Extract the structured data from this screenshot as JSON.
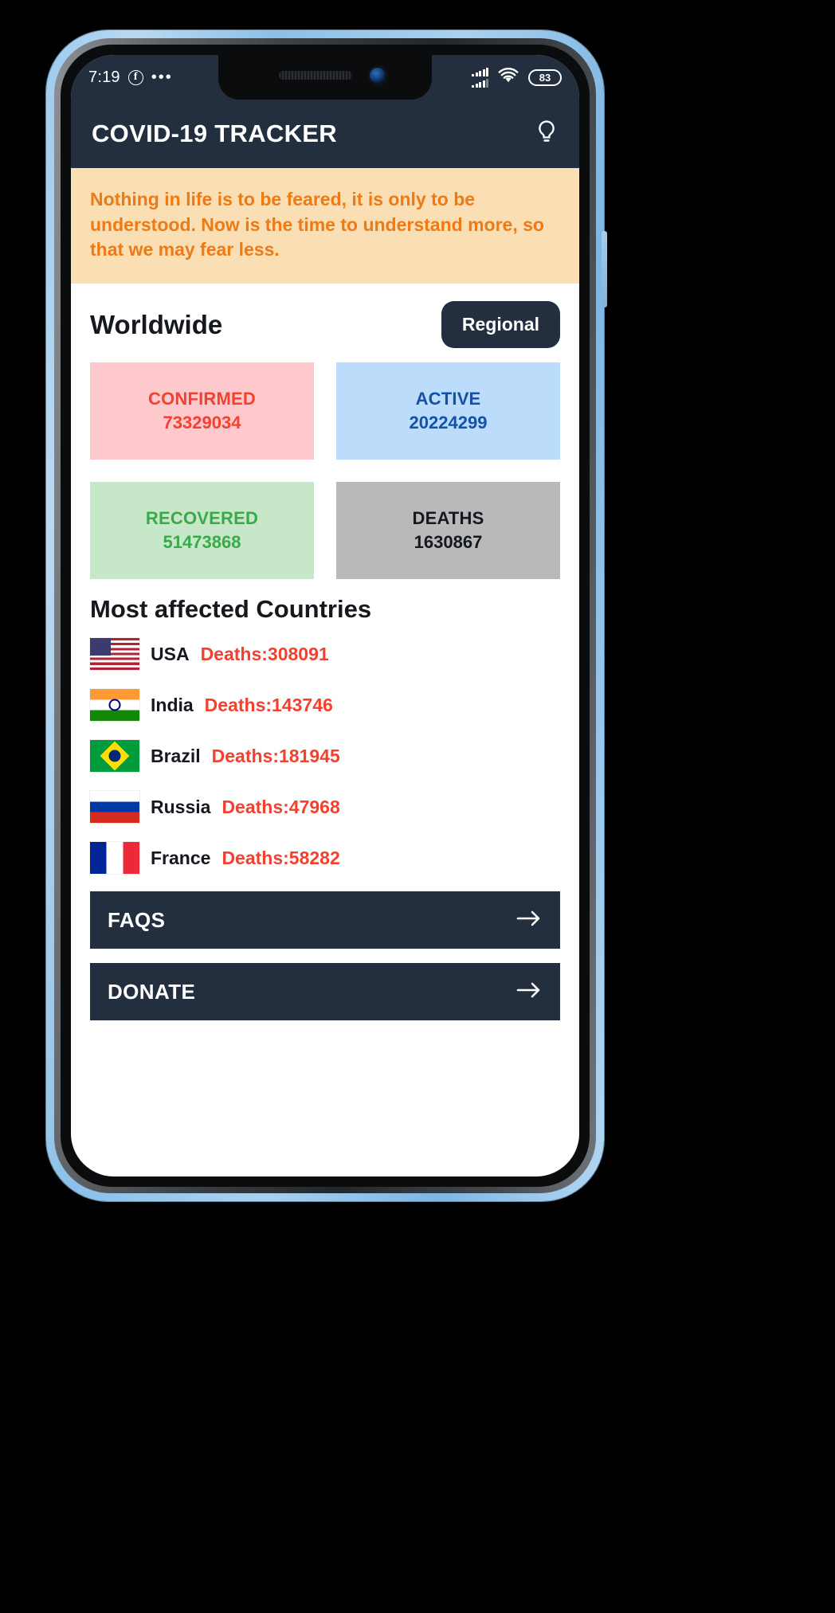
{
  "status_bar": {
    "time": "7:19",
    "facebook_icon": "facebook-icon",
    "more_icon": "more-dots-icon",
    "signal_icon": "cellular-signal-icon",
    "wifi_icon": "wifi-icon",
    "battery_level": "83"
  },
  "app_bar": {
    "title": "COVID-19 TRACKER",
    "action_icon": "lightbulb-icon"
  },
  "quote": {
    "text": "Nothing in life is to be feared, it is only to be understood. Now is the time to understand more, so that we may fear less."
  },
  "scope": {
    "title": "Worldwide",
    "toggle_label": "Regional"
  },
  "stats": [
    {
      "label": "CONFIRMED",
      "value": "73329034",
      "bg": "#fdc9cd",
      "fg": "#f4402e"
    },
    {
      "label": "ACTIVE",
      "value": "20224299",
      "bg": "#bbdcfa",
      "fg": "#1352a8"
    },
    {
      "label": "RECOVERED",
      "value": "51473868",
      "bg": "#c6e8c9",
      "fg": "#3aa94a"
    },
    {
      "label": "DEATHS",
      "value": "1630867",
      "bg": "#b9b9b9",
      "fg": "#15191f"
    }
  ],
  "countries_section": {
    "title": "Most affected Countries",
    "rows": [
      {
        "name": "USA",
        "deaths": "Deaths:308091",
        "flag": "flag-usa"
      },
      {
        "name": "India",
        "deaths": "Deaths:143746",
        "flag": "flag-india"
      },
      {
        "name": "Brazil",
        "deaths": "Deaths:181945",
        "flag": "flag-brazil"
      },
      {
        "name": "Russia",
        "deaths": "Deaths:47968",
        "flag": "flag-russia"
      },
      {
        "name": "France",
        "deaths": "Deaths:58282",
        "flag": "flag-france"
      }
    ]
  },
  "cta": [
    {
      "label": "FAQS",
      "icon": "arrow-right-icon"
    },
    {
      "label": "DONATE",
      "icon": "arrow-right-icon"
    }
  ],
  "colors": {
    "navy": "#232e3e",
    "quote_bg": "#fbdfb4",
    "quote_fg": "#ee7a16",
    "deaths_red": "#f4402e"
  }
}
